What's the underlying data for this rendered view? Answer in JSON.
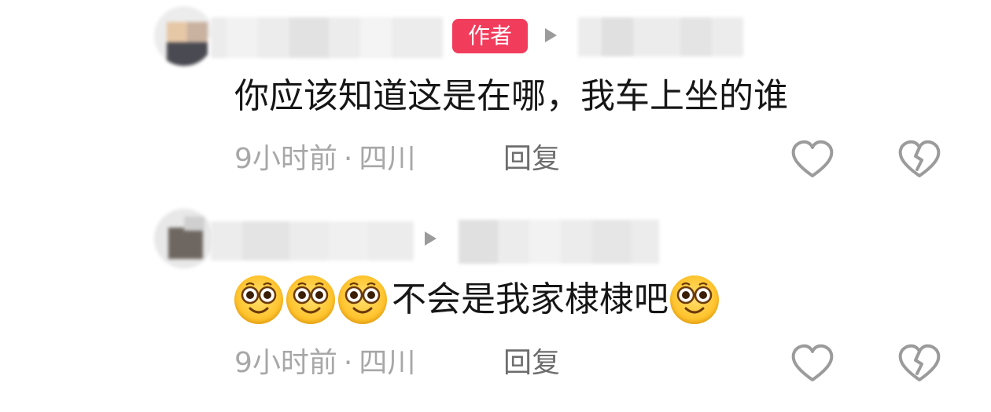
{
  "comments": [
    {
      "author_badge": "作者",
      "text": "你应该知道这是在哪，我车上坐的谁",
      "time": "9小时前",
      "separator": "·",
      "location": "四川",
      "reply_label": "回复"
    },
    {
      "emoji": "smile-emoji",
      "text": "不会是我家棣棣吧",
      "time": "9小时前",
      "separator": "·",
      "location": "四川",
      "reply_label": "回复"
    }
  ],
  "colors": {
    "badge": "#f23c5c",
    "meta_text": "#a7a7a7",
    "reply_text": "#6d6d6d",
    "icon_stroke": "#9b9b9b"
  },
  "icons": {
    "like": "heart-outline-icon",
    "dislike": "broken-heart-icon",
    "reply_to": "play-arrow-icon"
  }
}
